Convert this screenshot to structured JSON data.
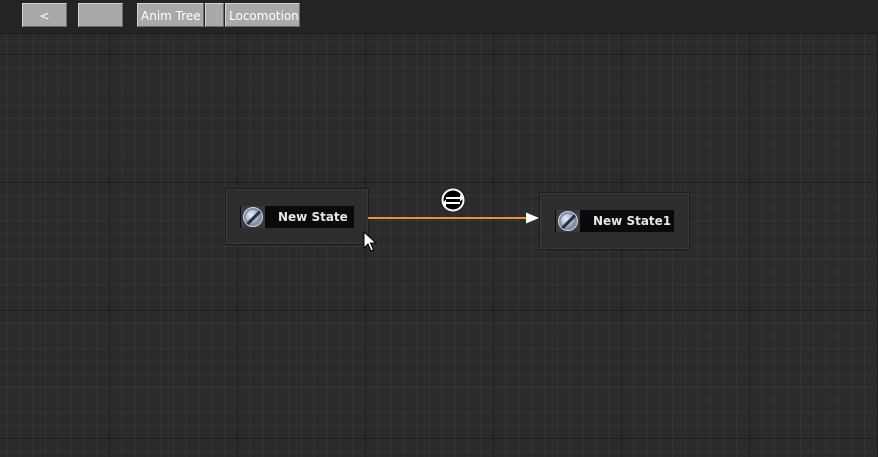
{
  "toolbar": {
    "back_label": "<",
    "forward_label": "",
    "breadcrumb": [
      {
        "label": "Anim Tree"
      },
      {
        "label": ""
      },
      {
        "label": "Locomotion"
      }
    ]
  },
  "graph": {
    "states": [
      {
        "name": "New State",
        "icon": "state-icon"
      },
      {
        "name": "New State1",
        "icon": "state-icon"
      }
    ],
    "transitions": [
      {
        "from": "New State",
        "to": "New State1",
        "icon": "transition-icon"
      }
    ]
  },
  "colors": {
    "background": "#2b2b2b",
    "transition_line": "#e8962c",
    "node_bg": "#2e2e2e",
    "node_title_bg": "#0a0a0a"
  }
}
